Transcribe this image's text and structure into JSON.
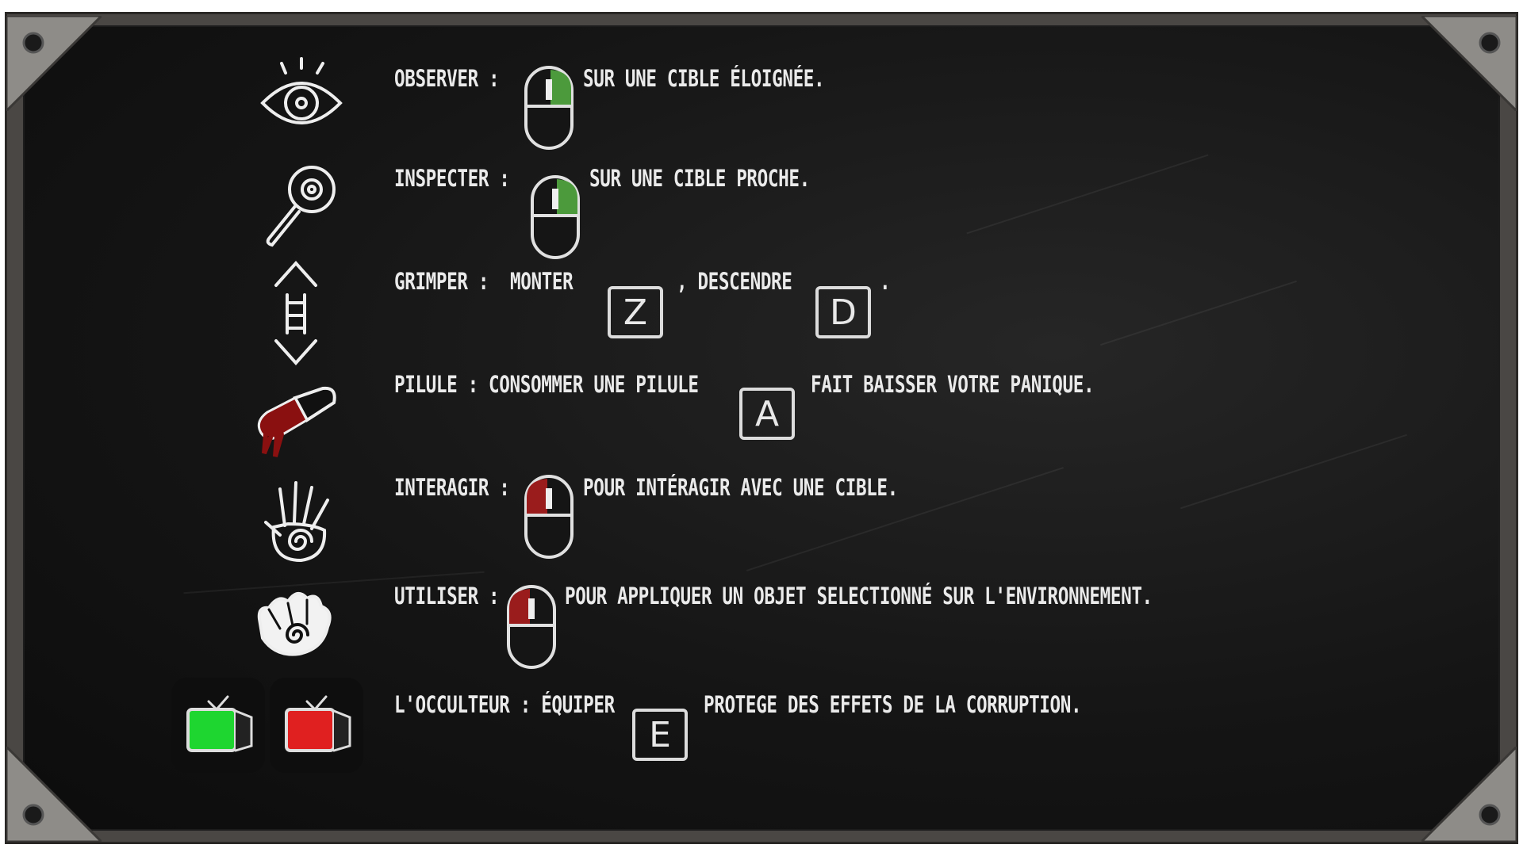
{
  "rows": [
    {
      "icon": "eye-icon",
      "label": "OBSERVER :",
      "mid": "",
      "key": "",
      "after": "SUR UNE CIBLE ÉLOIGNÉE.",
      "mouse": "right-green"
    },
    {
      "icon": "magnifier-eye-icon",
      "label": "INSPECTER :",
      "mid": "",
      "key": "",
      "after": "SUR UNE CIBLE PROCHE.",
      "mouse": "right-green"
    },
    {
      "icon": "ladder-icon",
      "label": "GRIMPER :",
      "climb_up": "MONTER",
      "key_up": "Z",
      "climb_sep": ", DESCENDRE",
      "key_down": "D",
      "climb_end": "."
    },
    {
      "icon": "pill-icon",
      "label": "PILULE : CONSOMMER UNE PILULE",
      "key": "A",
      "after": "FAIT BAISSER VOTRE PANIQUE."
    },
    {
      "icon": "hand-spiral-icon",
      "label": "INTERAGIR :",
      "after": "POUR INTÉRAGIR AVEC UNE CIBLE.",
      "mouse": "left-red"
    },
    {
      "icon": "grab-hand-icon",
      "label": "UTILISER :",
      "after": "POUR APPLIQUER UN OBJET SELECTIONNÉ SUR L'ENVIRONNEMENT.",
      "mouse": "left-red"
    },
    {
      "icon": "occulteur-tv-icon",
      "label": "L'OCCULTEUR : ÉQUIPER",
      "key": "E",
      "after": "PROTEGE DES EFFETS DE LA CORRUPTION."
    }
  ],
  "colors": {
    "mouse_green": "#4c9a3c",
    "mouse_red": "#9a1c1c",
    "tv_green": "#1ed630",
    "tv_red": "#e02020",
    "pill_red": "#8a1010"
  }
}
